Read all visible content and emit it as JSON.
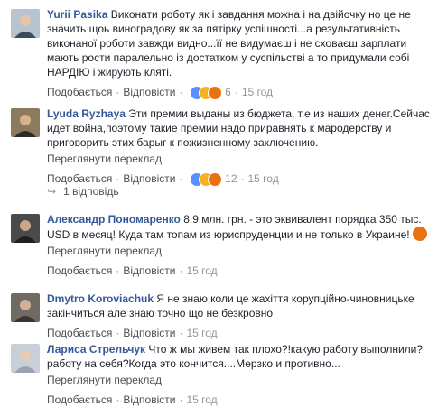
{
  "comments": [
    {
      "author": "Yurii Pasika",
      "text": "Виконати роботу як і завдання можна і на двійочку но це не значить щоь виноградову як за пятірку успішності...а результативність виконаної роботи завжди видно...її не видумаєш і не сховаєш.зарплати мають рости паралельно із достатком у суспільстві а то придумали собі НАРДІЮ і жирують кляті.",
      "like_label": "Подобається",
      "reply_label": "Відповісти",
      "reaction_count": "6",
      "time": "15 год"
    },
    {
      "author": "Lyuda Ryzhaya",
      "text": "Эти премии выданы из бюджета, т.е из наших денег.Сейчас идет война,поэтому такие премии надо приравнять к мародерству и приговорить этих барыг к пожизненному заключению.",
      "translate_label": "Переглянути переклад",
      "like_label": "Подобається",
      "reply_label": "Відповісти",
      "reaction_count": "12",
      "time": "15 год",
      "replies_label": "1 відповідь"
    },
    {
      "author": "Александр Пономаренко",
      "text": "8.9 млн. грн. - это эквивалент порядка 350 тыс. USD в месяц! Куда там топам из юриспруденции и не только в Украине!",
      "translate_label": "Переглянути переклад",
      "like_label": "Подобається",
      "reply_label": "Відповісти",
      "time": "15 год"
    },
    {
      "author": "Dmytro Koroviachuk",
      "text": "Я не знаю коли це жахіття корупційно-чиновницьке закінчиться але знаю точно що не безкровно",
      "like_label": "Подобається",
      "reply_label": "Відповісти",
      "time": "15 год"
    },
    {
      "author": "Лариса Стрельчук",
      "text": "Что ж мы живем так плохо?!какую работу выполнили? работу на себя?Когда это кончится....Мерзко и противно...",
      "translate_label": "Переглянути переклад",
      "like_label": "Подобається",
      "reply_label": "Відповісти",
      "time": "15 год"
    }
  ],
  "colors": {
    "author": "#365899",
    "meta": "#90949c",
    "link": "#4b4f56",
    "like": "#5890ff",
    "angry": "#e9710f"
  }
}
